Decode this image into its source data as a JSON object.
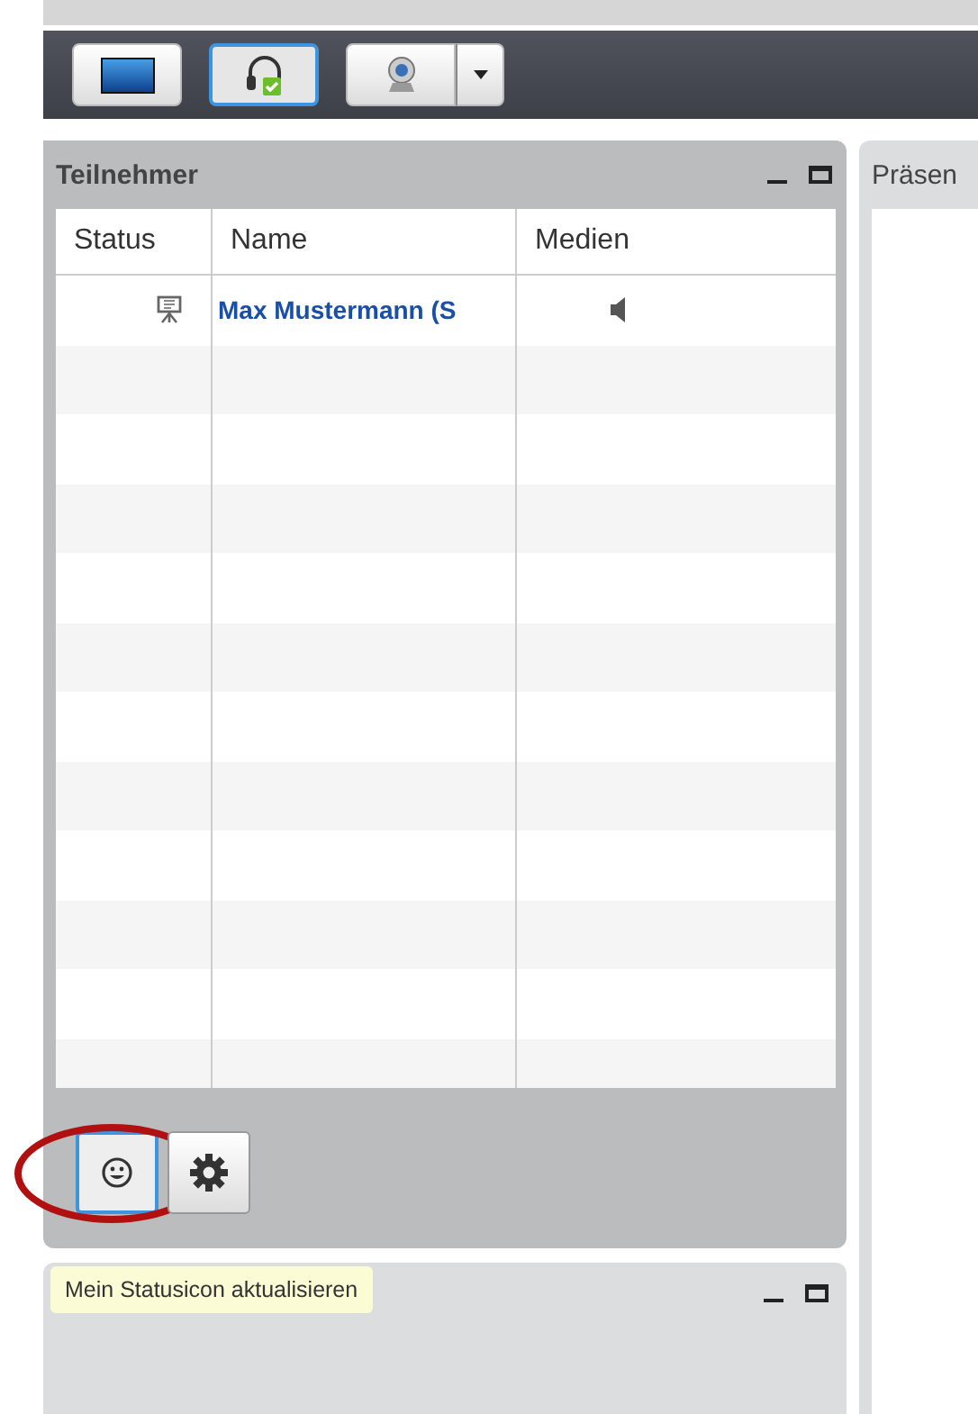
{
  "toolbar": [
    {
      "kind": "screen",
      "selected": false
    },
    {
      "kind": "headset",
      "selected": true
    },
    {
      "kind": "webcam",
      "selected": false,
      "dropdown": true
    }
  ],
  "participants_panel": {
    "title": "Teilnehmer",
    "columns": [
      "Status",
      "Name",
      "Medien"
    ],
    "rows": [
      {
        "cells": [
          {
            "kind": "presenter"
          },
          {
            "kind": "name",
            "text": "Max Mustermann (S"
          },
          {
            "kind": "speaker"
          }
        ]
      }
    ]
  },
  "presentation_panel": {
    "title": "Präsen"
  },
  "bottom_buttons": [
    {
      "kind": "smiley",
      "selected": true,
      "highlighted": true
    },
    {
      "kind": "gear",
      "selected": false,
      "highlighted": false
    }
  ],
  "tooltip": "Mein Statusicon aktualisieren"
}
